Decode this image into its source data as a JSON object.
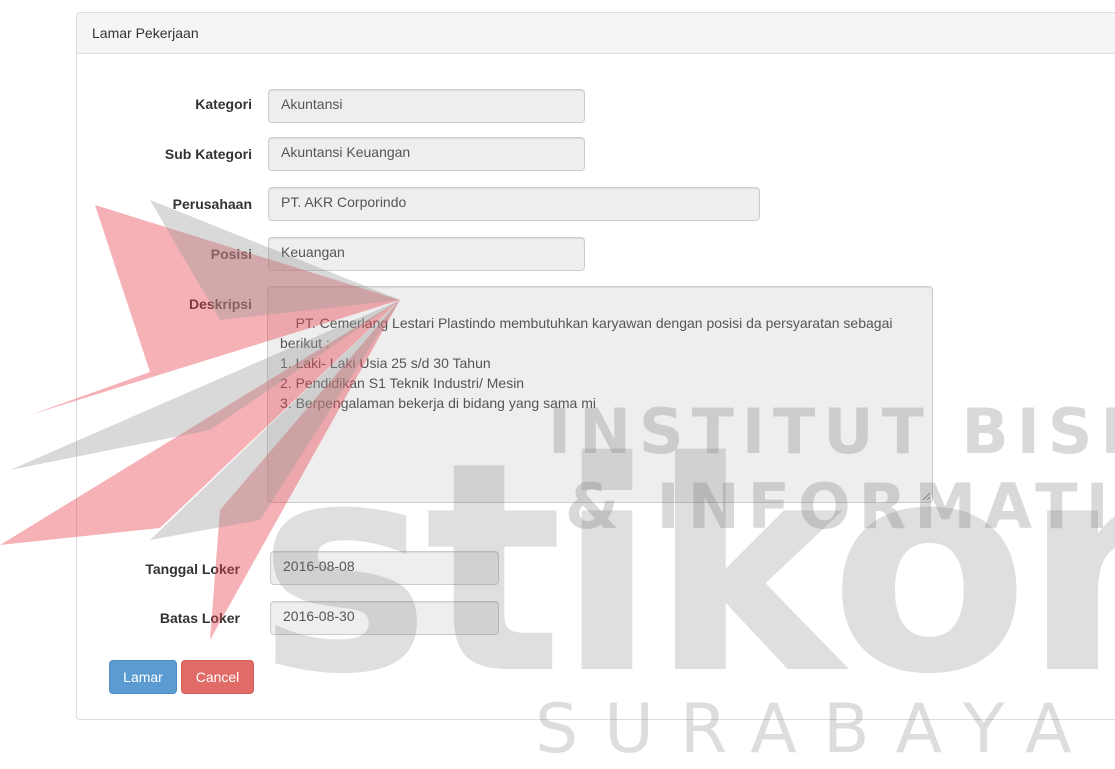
{
  "panel": {
    "title": "Lamar Pekerjaan"
  },
  "form": {
    "kategori": {
      "label": "Kategori",
      "value": "Akuntansi"
    },
    "sub_kategori": {
      "label": "Sub Kategori",
      "value": "Akuntansi Keuangan"
    },
    "perusahaan": {
      "label": "Perusahaan",
      "value": "PT. AKR Corporindo"
    },
    "posisi": {
      "label": "Posisi",
      "value": "Keuangan"
    },
    "deskripsi": {
      "label": "Deskripsi",
      "value": "PT. Cemerlang Lestari Plastindo membutuhkan karyawan dengan posisi da persyaratan sebagai berikut :\n1. Laki- Laki Usia 25 s/d 30 Tahun\n2. Pendidikan S1 Teknik Industri/ Mesin\n3. Berpengalaman bekerja di bidang yang sama mi"
    },
    "tanggal_loker": {
      "label": "Tanggal Loker",
      "value": "2016-08-08"
    },
    "batas_loker": {
      "label": "Batas Loker",
      "value": "2016-08-30"
    }
  },
  "buttons": {
    "lamar": "Lamar",
    "cancel": "Cancel"
  },
  "watermark": {
    "line1": "INSTITUT BISNIS",
    "line2": "& INFORMATIKA",
    "brand": "stikom",
    "city": "SURABAYA"
  },
  "colors": {
    "primary_button": "#5b9bd1",
    "danger_button": "#e06b67",
    "watermark_red": "#e8464f",
    "watermark_gray": "#b0b0b0"
  }
}
